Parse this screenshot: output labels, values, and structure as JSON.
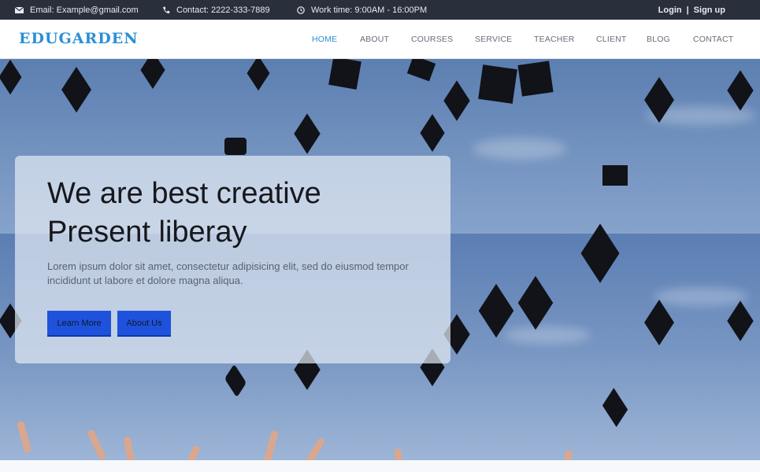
{
  "topbar": {
    "email_icon": "envelope-icon",
    "email": "Email: Example@gmail.com",
    "phone_icon": "phone-icon",
    "contact": "Contact: 2222-333-7889",
    "clock_icon": "clock-icon",
    "worktime": "Work time: 9:00AM - 16:00PM",
    "login": "Login",
    "separator": "|",
    "signup": "Sign up"
  },
  "header": {
    "logo": "EDUGARDEN",
    "nav": [
      {
        "label": "HOME",
        "active": true
      },
      {
        "label": "ABOUT",
        "active": false
      },
      {
        "label": "COURSES",
        "active": false
      },
      {
        "label": "SERVICE",
        "active": false
      },
      {
        "label": "TEACHER",
        "active": false
      },
      {
        "label": "CLIENT",
        "active": false
      },
      {
        "label": "BLOG",
        "active": false
      },
      {
        "label": "CONTACT",
        "active": false
      }
    ]
  },
  "hero": {
    "headline_line1": "We are best creative",
    "headline_line2": "Present liberay",
    "subtext": "Lorem ipsum dolor sit amet, consectetur adipisicing elit, sed do eiusmod tempor incididunt ut labore et dolore magna aliqua.",
    "learn_more": "Learn More",
    "about_us": "About Us"
  },
  "colors": {
    "topbar_bg": "#2a2f3c",
    "brand_blue": "#2b8fd6",
    "button_blue": "#1e52dc"
  }
}
